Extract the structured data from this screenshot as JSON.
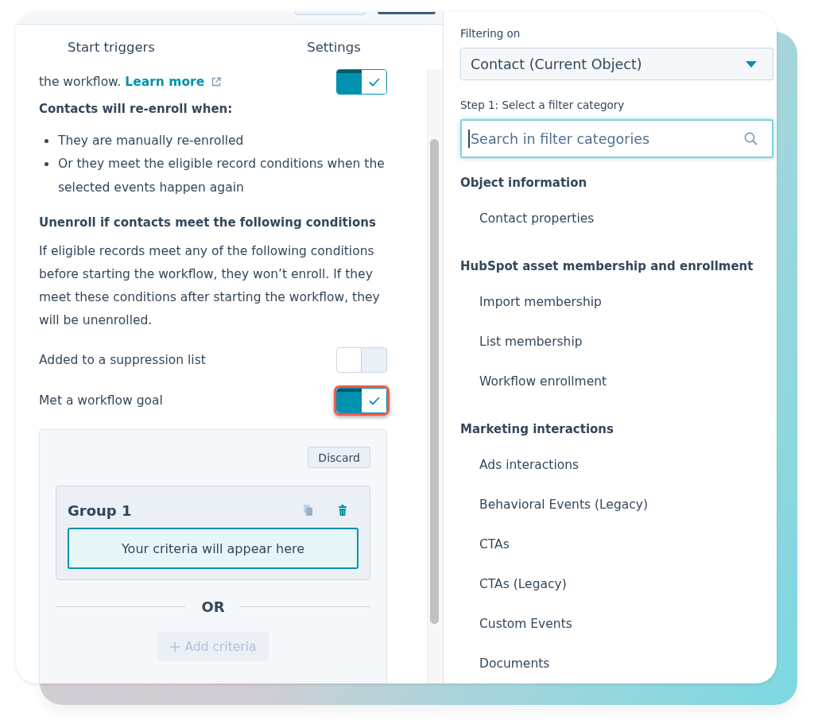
{
  "toolbar_buttons": [
    {
      "kind": "secondary"
    },
    {
      "kind": "primary"
    }
  ],
  "tabs": [
    {
      "label": "Start triggers",
      "selected": false
    },
    {
      "label": "Settings",
      "selected": false
    }
  ],
  "intro": {
    "text": "the workflow.",
    "link": "Learn more",
    "toggle_on": true
  },
  "reenroll": {
    "heading": "Contacts will re-enroll when:",
    "bullets": [
      "They are manually re-enrolled",
      "Or they meet the eligible record conditions when the selected events happen again"
    ]
  },
  "unenroll": {
    "heading": "Unenroll if contacts meet the following conditions",
    "description": "If eligible records meet any of the following conditions before starting the workflow, they won’t enroll. If they meet these conditions after starting the workflow, they will be unenrolled.",
    "options": [
      {
        "label": "Added to a suppression list",
        "on": false,
        "highlighted": false
      },
      {
        "label": "Met a workflow goal",
        "on": true,
        "highlighted": true
      }
    ]
  },
  "criteria": {
    "discard": "Discard",
    "groups": [
      {
        "title": "Group 1",
        "placeholder": "Your criteria will appear here"
      }
    ],
    "divider": "OR",
    "add_button": {
      "label": "Add criteria",
      "disabled": true
    }
  },
  "filter_panel": {
    "filtering_label": "Filtering on",
    "object_select": "Contact (Current Object)",
    "step_label": "Step 1: Select a filter category",
    "search": {
      "placeholder": "Search in filter categories",
      "focused": true
    },
    "categories": [
      {
        "heading": "Object information",
        "items": [
          "Contact properties"
        ]
      },
      {
        "heading": "HubSpot asset membership and enrollment",
        "items": [
          "Import membership",
          "List membership",
          "Workflow enrollment"
        ]
      },
      {
        "heading": "Marketing interactions",
        "items": [
          "Ads interactions",
          "Behavioral Events (Legacy)",
          "CTAs",
          "CTAs (Legacy)",
          "Custom Events",
          "Documents"
        ]
      }
    ]
  }
}
